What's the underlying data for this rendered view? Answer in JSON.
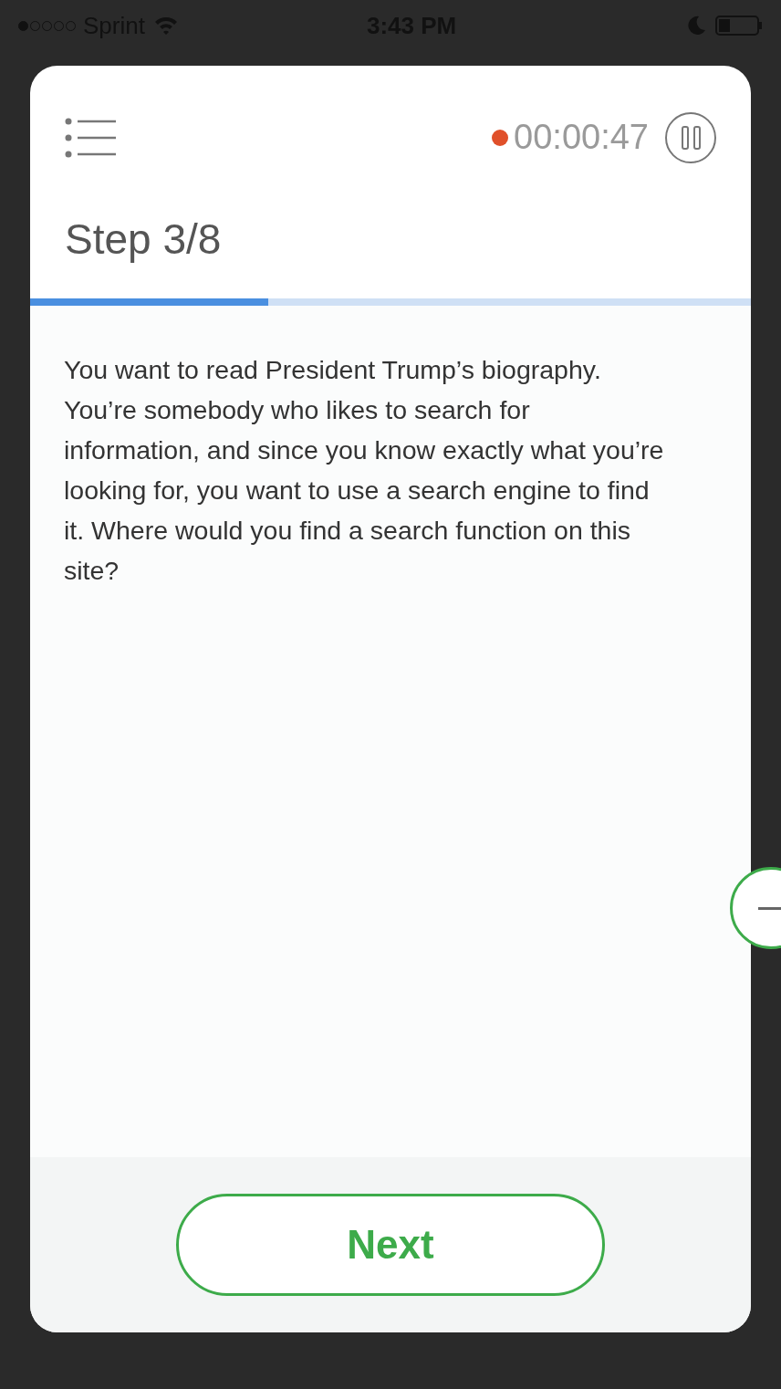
{
  "status_bar": {
    "carrier": "Sprint",
    "signal_dots": [
      {
        "filled": true
      },
      {
        "filled": false
      },
      {
        "filled": false
      },
      {
        "filled": false
      },
      {
        "filled": false
      }
    ],
    "time": "3:43 PM"
  },
  "header": {
    "recording": true,
    "timer": "00:00:47"
  },
  "step": {
    "title": "Step 3/8",
    "level": 0.33
  },
  "task": "You want to read President Trump’s biography. You’re somebody who likes to search for information, and since you know exactly what you’re looking for, you want to use a search engine to find it. Where would you find a search function on this site?",
  "next_button": "Next"
}
